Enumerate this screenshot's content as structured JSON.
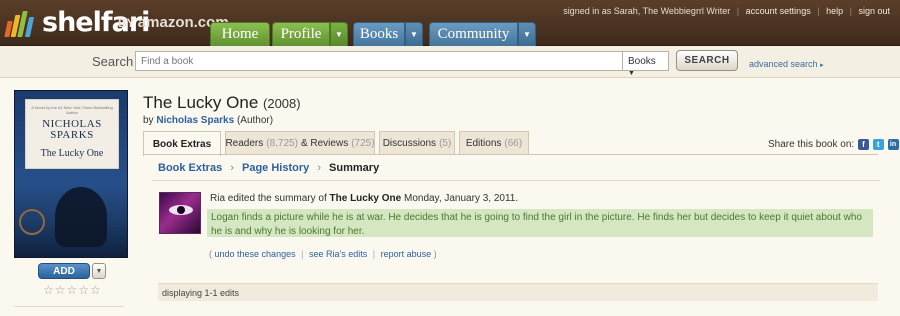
{
  "header": {
    "logo": "shelfari",
    "by": "BY",
    "amazon": "amazon.com",
    "nav": [
      {
        "label": "Home"
      },
      {
        "label": "Profile"
      },
      {
        "label": "Books"
      },
      {
        "label": "Community"
      }
    ],
    "signed_in_text": "signed in as Sarah, The Webbiegrrl Writer",
    "account_settings": "account settings",
    "help": "help",
    "sign_out": "sign out",
    "separator": "|",
    "colors": {
      "bg": "#4a3322",
      "green": "#6fa33c",
      "blue": "#527fa6"
    }
  },
  "search": {
    "label": "Search",
    "placeholder": "Find a book",
    "category": "Books",
    "button": "SEARCH",
    "advanced": "advanced search"
  },
  "book": {
    "title": "The Lucky One",
    "year": "(2008)",
    "by": "by",
    "author": "Nicholas Sparks",
    "role": "(Author)",
    "cover_small": "A Novel by the #1 New York Times Bestselling Author",
    "cover_author": "NICHOLAS SPARKS",
    "cover_title": "The Lucky One",
    "add_button": "ADD",
    "rating_stars": "☆☆☆☆☆"
  },
  "tabs": [
    {
      "label": "Book Extras",
      "count": ""
    },
    {
      "label": "Readers",
      "count": "(8,725)",
      "extra": "& Reviews",
      "extra_count": "(725)"
    },
    {
      "label": "Discussions",
      "count": "(5)"
    },
    {
      "label": "Editions",
      "count": "(66)"
    }
  ],
  "share": {
    "label": "Share this book on:",
    "icons": [
      {
        "name": "facebook-icon",
        "glyph": "f",
        "color": "#3b5998"
      },
      {
        "name": "twitter-icon",
        "glyph": "t",
        "color": "#3aa3d8"
      },
      {
        "name": "linkedin-icon",
        "glyph": "in",
        "color": "#2a6ea5"
      }
    ]
  },
  "breadcrumb": {
    "items": [
      "Book Extras",
      "Page History"
    ],
    "current": "Summary",
    "separator": "›"
  },
  "edit": {
    "user": "Ria",
    "action": "edited the summary of",
    "book": "The Lucky One",
    "date": "Monday, January 3, 2011.",
    "summary": "Logan finds a picture while he is at war. He decides that he is going to find the girl in the picture. He finds her but decides to keep it quiet about who he is and why he is looking for her.",
    "actions": [
      "undo these changes",
      "see Ria's edits",
      "report abuse"
    ],
    "summary_bg": "#d5e6c3"
  },
  "footer": {
    "displaying": "displaying 1-1 edits"
  }
}
